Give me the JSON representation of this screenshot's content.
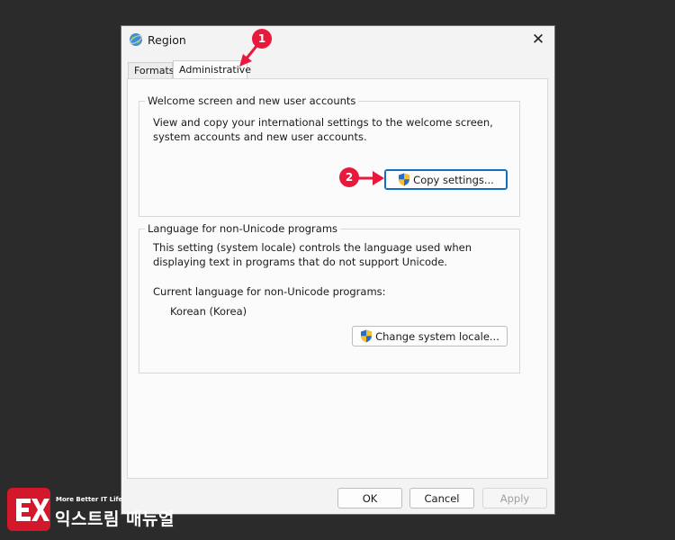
{
  "window": {
    "title": "Region",
    "close_symbol": "✕"
  },
  "tabs": [
    {
      "label": "Formats",
      "selected": false
    },
    {
      "label": "Administrative",
      "selected": true
    }
  ],
  "welcome_group": {
    "title": "Welcome screen and new user accounts",
    "description": "View and copy your international settings to the welcome screen, system accounts and new user accounts.",
    "button_label": "Copy settings..."
  },
  "language_group": {
    "title": "Language for non-Unicode programs",
    "description": "This setting (system locale) controls the language used when displaying text in programs that do not support Unicode.",
    "current_label": "Current language for non-Unicode programs:",
    "current_value": "Korean (Korea)",
    "button_label": "Change system locale..."
  },
  "footer": {
    "ok_label": "OK",
    "cancel_label": "Cancel",
    "apply_label": "Apply"
  },
  "annotations": {
    "marker_1": "1",
    "marker_2": "2"
  },
  "brand": {
    "tagline": "More Better IT Life",
    "name": "익스트림 매뉴얼"
  },
  "colors": {
    "accent": "#0f6fc4",
    "annotation_red": "#e8193c",
    "background": "#2b2b2b",
    "window": "#f3f3f3"
  }
}
